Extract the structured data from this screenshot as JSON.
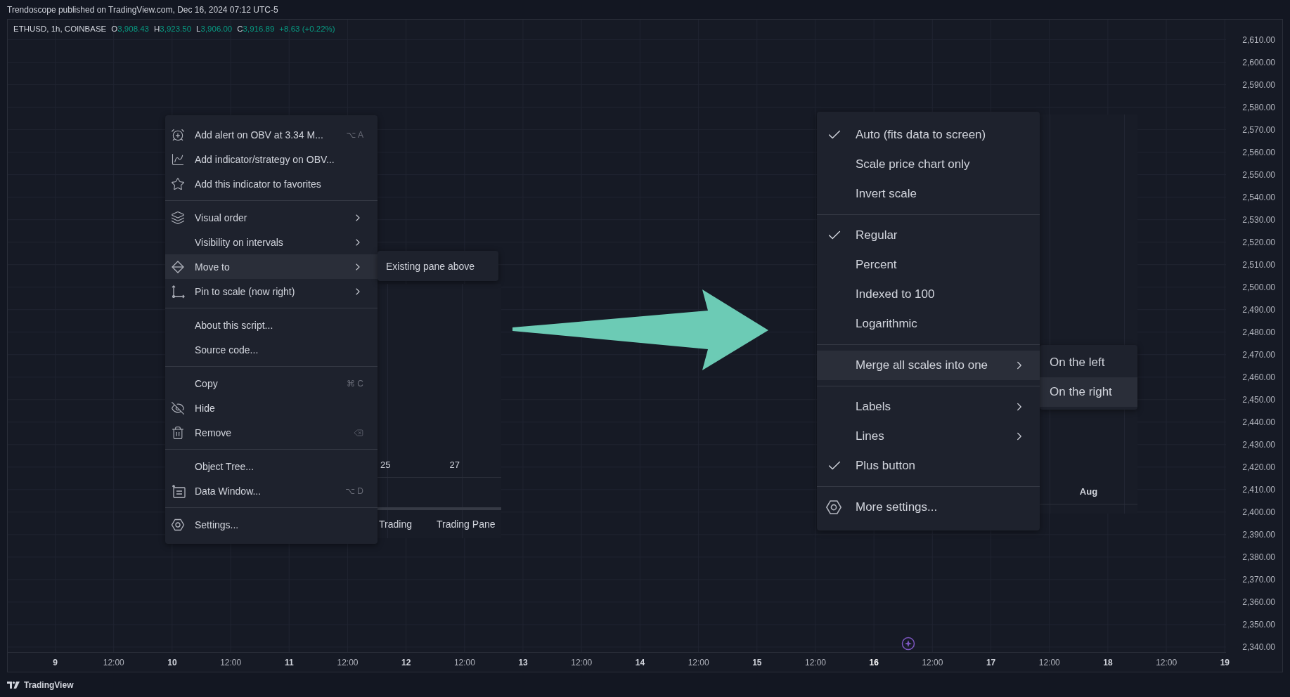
{
  "header": {
    "title": "Trendoscope published on TradingView.com, Dec 16, 2024 07:12 UTC-5"
  },
  "legend": {
    "symbol": "ETHUSD, 1h, COINBASE",
    "ohlc": [
      {
        "label": "O",
        "value": "3,908.43"
      },
      {
        "label": "H",
        "value": "3,923.50"
      },
      {
        "label": "L",
        "value": "3,906.00"
      },
      {
        "label": "C",
        "value": "3,916.89"
      }
    ],
    "change": "+8.63 (+0.22%)"
  },
  "left_menu": {
    "groups": [
      {
        "items": [
          {
            "label": "Add alert on OBV at 3.34 M...",
            "shortcut": "⌥ A",
            "has_submenu": false,
            "selected": false
          },
          {
            "label": "Add indicator/strategy on OBV...",
            "has_submenu": false,
            "selected": false
          },
          {
            "label": "Add this indicator to favorites",
            "has_submenu": false,
            "selected": false
          }
        ]
      },
      {
        "items": [
          {
            "label": "Visual order",
            "has_submenu": true,
            "selected": false
          },
          {
            "label": "Visibility on intervals",
            "has_submenu": true,
            "selected": false
          },
          {
            "label": "Move to",
            "has_submenu": true,
            "selected": true
          },
          {
            "label": "Pin to scale (now right)",
            "has_submenu": true,
            "selected": false
          }
        ]
      },
      {
        "items": [
          {
            "label": "About this script...",
            "has_submenu": false,
            "selected": false
          },
          {
            "label": "Source code...",
            "has_submenu": false,
            "selected": false
          }
        ]
      },
      {
        "items": [
          {
            "label": "Copy",
            "shortcut": "⌘ C",
            "has_submenu": false,
            "selected": false
          },
          {
            "label": "Hide",
            "has_submenu": false,
            "selected": false
          },
          {
            "label": "Remove",
            "has_submenu": false,
            "selected": false
          }
        ]
      },
      {
        "items": [
          {
            "label": "Object Tree...",
            "has_submenu": false,
            "selected": false
          },
          {
            "label": "Data Window...",
            "shortcut": "⌥ D",
            "has_submenu": false,
            "selected": false
          }
        ]
      },
      {
        "items": [
          {
            "label": "Settings...",
            "has_submenu": false,
            "selected": false
          }
        ]
      }
    ]
  },
  "left_submenu": {
    "items": [
      {
        "label": "Existing pane above",
        "selected": false
      }
    ]
  },
  "left_fragment": {
    "dates": [
      "25",
      "27"
    ],
    "tabs": [
      "Trading",
      "Trading Pane"
    ]
  },
  "right_menu": {
    "groups": [
      {
        "items": [
          {
            "label": "Auto (fits data to screen)",
            "checked": true,
            "has_submenu": false,
            "selected": false
          },
          {
            "label": "Scale price chart only",
            "checked": false,
            "has_submenu": false,
            "selected": false
          },
          {
            "label": "Invert scale",
            "checked": false,
            "has_submenu": false,
            "selected": false
          }
        ]
      },
      {
        "items": [
          {
            "label": "Regular",
            "checked": true,
            "has_submenu": false,
            "selected": false
          },
          {
            "label": "Percent",
            "checked": false,
            "has_submenu": false,
            "selected": false
          },
          {
            "label": "Indexed to 100",
            "checked": false,
            "has_submenu": false,
            "selected": false
          },
          {
            "label": "Logarithmic",
            "checked": false,
            "has_submenu": false,
            "selected": false
          }
        ]
      },
      {
        "items": [
          {
            "label": "Merge all scales into one",
            "checked": false,
            "has_submenu": true,
            "selected": true
          }
        ]
      },
      {
        "items": [
          {
            "label": "Labels",
            "checked": false,
            "has_submenu": true,
            "selected": false
          },
          {
            "label": "Lines",
            "checked": false,
            "has_submenu": true,
            "selected": false
          },
          {
            "label": "Plus button",
            "checked": true,
            "has_submenu": false,
            "selected": false
          }
        ]
      },
      {
        "items": [
          {
            "label": "More settings...",
            "checked": false,
            "has_submenu": false,
            "selected": false
          }
        ]
      }
    ]
  },
  "right_submenu": {
    "items": [
      {
        "label": "On the left",
        "selected": false
      },
      {
        "label": "On the right",
        "selected": true
      }
    ]
  },
  "right_fragment": {
    "date": "Aug"
  },
  "price_axis": [
    "2,610.00",
    "2,600.00",
    "2,590.00",
    "2,580.00",
    "2,570.00",
    "2,560.00",
    "2,550.00",
    "2,540.00",
    "2,530.00",
    "2,520.00",
    "2,510.00",
    "2,500.00",
    "2,490.00",
    "2,480.00",
    "2,470.00",
    "2,460.00",
    "2,450.00",
    "2,440.00",
    "2,430.00",
    "2,420.00",
    "2,410.00",
    "2,400.00",
    "2,390.00",
    "2,380.00",
    "2,370.00",
    "2,360.00",
    "2,350.00",
    "2,340.00"
  ],
  "time_axis": [
    {
      "label": "9",
      "kind": "day",
      "current": false
    },
    {
      "label": "12:00",
      "kind": "time",
      "current": false
    },
    {
      "label": "10",
      "kind": "day",
      "current": false
    },
    {
      "label": "12:00",
      "kind": "time",
      "current": false
    },
    {
      "label": "11",
      "kind": "day",
      "current": false
    },
    {
      "label": "12:00",
      "kind": "time",
      "current": false
    },
    {
      "label": "12",
      "kind": "day",
      "current": false
    },
    {
      "label": "12:00",
      "kind": "time",
      "current": false
    },
    {
      "label": "13",
      "kind": "day",
      "current": false
    },
    {
      "label": "12:00",
      "kind": "time",
      "current": false
    },
    {
      "label": "14",
      "kind": "day",
      "current": false
    },
    {
      "label": "12:00",
      "kind": "time",
      "current": false
    },
    {
      "label": "15",
      "kind": "day",
      "current": false
    },
    {
      "label": "12:00",
      "kind": "time",
      "current": false
    },
    {
      "label": "16",
      "kind": "day",
      "current": true
    },
    {
      "label": "12:00",
      "kind": "time",
      "current": false
    },
    {
      "label": "17",
      "kind": "day",
      "current": false
    },
    {
      "label": "12:00",
      "kind": "time",
      "current": false
    },
    {
      "label": "18",
      "kind": "day",
      "current": false
    },
    {
      "label": "12:00",
      "kind": "time",
      "current": false
    },
    {
      "label": "19",
      "kind": "day",
      "current": false
    }
  ],
  "footer": {
    "brand": "TradingView"
  }
}
